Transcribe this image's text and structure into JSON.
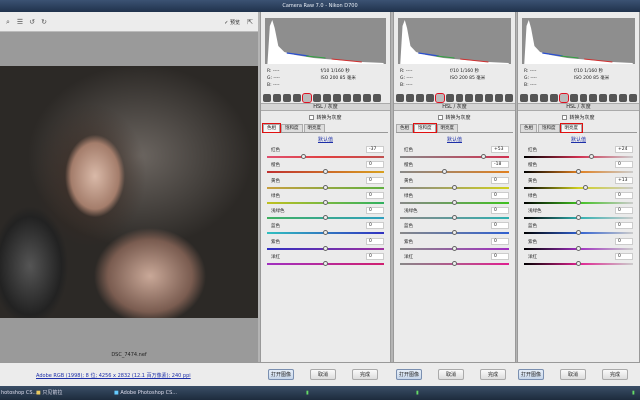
{
  "window": {
    "title": "Camera Raw 7.0 - Nikon D700"
  },
  "toolbar": {
    "preview_label": "✓ 预览",
    "icons": [
      "zoom-icon",
      "list-icon",
      "rotate-left-icon",
      "rotate-right-icon"
    ]
  },
  "image": {
    "filename": "DSC_7474.nef"
  },
  "workflow": {
    "link": "Adobe RGB (1998); 8 位; 4256 x 2832 (12.1 百万像素); 240 ppi"
  },
  "buttons": {
    "open": "打开图像",
    "cancel": "取消",
    "done": "完成"
  },
  "taskbar": {
    "items": [
      "hotoshop CS...",
      "只见箭拉",
      "Adobe Photoshop CS..."
    ]
  },
  "panels": [
    {
      "info": {
        "r": "R:  ----",
        "g": "G:  ----",
        "b": "B:  ----",
        "exposure": "f/10   1/160 秒",
        "iso": "ISO 200   85 毫米"
      },
      "header": "HSL / 灰度",
      "gray_label": "转换为灰度",
      "tabs": [
        "色相",
        "饱和度",
        "明亮度"
      ],
      "active_tab": 0,
      "default_label": "默认值",
      "rows": [
        {
          "label": "红色",
          "value": "-37"
        },
        {
          "label": "橙色",
          "value": "0"
        },
        {
          "label": "黄色",
          "value": "0"
        },
        {
          "label": "绿色",
          "value": "0"
        },
        {
          "label": "浅绿色",
          "value": "0"
        },
        {
          "label": "蓝色",
          "value": "0"
        },
        {
          "label": "紫色",
          "value": "0"
        },
        {
          "label": "洋红",
          "value": "0"
        }
      ]
    },
    {
      "info": {
        "r": "R:  ----",
        "g": "G:  ----",
        "b": "B:  ----",
        "exposure": "f/10   1/160 秒",
        "iso": "ISO 200   85 毫米"
      },
      "header": "HSL / 灰度",
      "gray_label": "转换为灰度",
      "tabs": [
        "色相",
        "饱和度",
        "明亮度"
      ],
      "active_tab": 1,
      "default_label": "默认值",
      "rows": [
        {
          "label": "红色",
          "value": "+53"
        },
        {
          "label": "橙色",
          "value": "-18"
        },
        {
          "label": "黄色",
          "value": "0"
        },
        {
          "label": "绿色",
          "value": "0"
        },
        {
          "label": "浅绿色",
          "value": "0"
        },
        {
          "label": "蓝色",
          "value": "0"
        },
        {
          "label": "紫色",
          "value": "0"
        },
        {
          "label": "洋红",
          "value": "0"
        }
      ]
    },
    {
      "info": {
        "r": "R:  ----",
        "g": "G:  ----",
        "b": "B:  ----",
        "exposure": "f/10   1/160 秒",
        "iso": "ISO 200   85 毫米"
      },
      "header": "HSL / 灰度",
      "gray_label": "转换为灰度",
      "tabs": [
        "色相",
        "饱和度",
        "明亮度"
      ],
      "active_tab": 2,
      "default_label": "默认值",
      "rows": [
        {
          "label": "红色",
          "value": "+24"
        },
        {
          "label": "橙色",
          "value": "0"
        },
        {
          "label": "黄色",
          "value": "+13"
        },
        {
          "label": "绿色",
          "value": "0"
        },
        {
          "label": "浅绿色",
          "value": "0"
        },
        {
          "label": "蓝色",
          "value": "0"
        },
        {
          "label": "紫色",
          "value": "0"
        },
        {
          "label": "洋红",
          "value": "0"
        }
      ]
    }
  ],
  "colors": {
    "highlight": "#e01010",
    "link": "#1d2fa8",
    "title_bar": "#2c4060"
  }
}
